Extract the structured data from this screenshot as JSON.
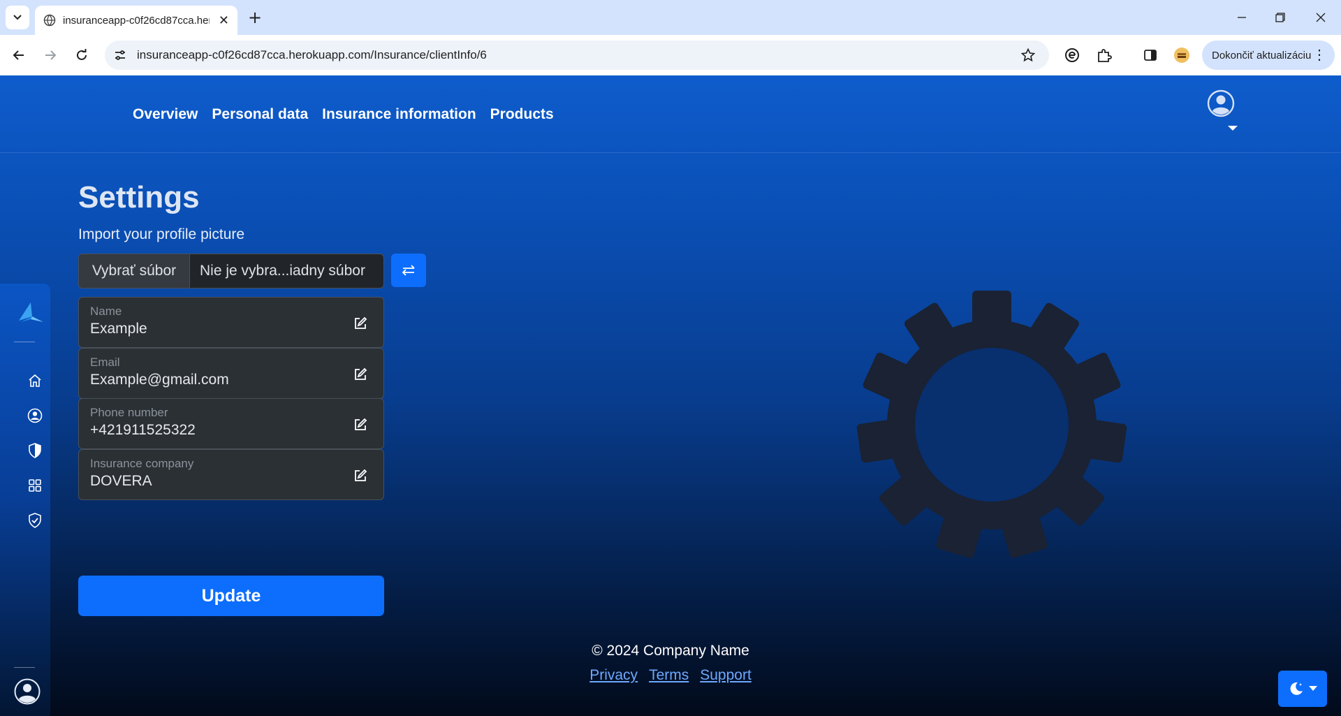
{
  "browser": {
    "tab_title": "insuranceapp-c0f26cd87cca.her",
    "tab_close": "✕",
    "new_tab": "+",
    "url": "insuranceapp-c0f26cd87cca.herokuapp.com/Insurance/clientInfo/6",
    "update_button_label": "Dokončiť aktualizáciu",
    "update_button_more": "⋮"
  },
  "topnav": {
    "links": [
      "Overview",
      "Personal data",
      "Insurance information",
      "Products"
    ]
  },
  "sidebar": {
    "items": [
      "home-icon",
      "person-circle-icon",
      "shield-half-icon",
      "grid-icon",
      "shield-check-icon"
    ]
  },
  "settings": {
    "title": "Settings",
    "import_label": "Import your profile picture",
    "file_button_label": "Vybrať súbor",
    "file_status": "Nie je vybra...iadny súbor",
    "fields": [
      {
        "label": "Name",
        "value": "Example"
      },
      {
        "label": "Email",
        "value": "Example@gmail.com"
      },
      {
        "label": "Phone number",
        "value": "+421911525322"
      },
      {
        "label": "Insurance company",
        "value": "DOVERA"
      }
    ],
    "submit_label": "Update"
  },
  "footer": {
    "copyright": "© 2024 Company Name",
    "links": [
      "Privacy",
      "Terms",
      "Support"
    ]
  },
  "colors": {
    "primary": "#0d6efd",
    "nav_gradient_top": "#0e5ccc",
    "page_bottom": "#020a1a",
    "field_bg": "#2b3035",
    "gear": "#1a2233",
    "link": "#6ea8fe"
  }
}
